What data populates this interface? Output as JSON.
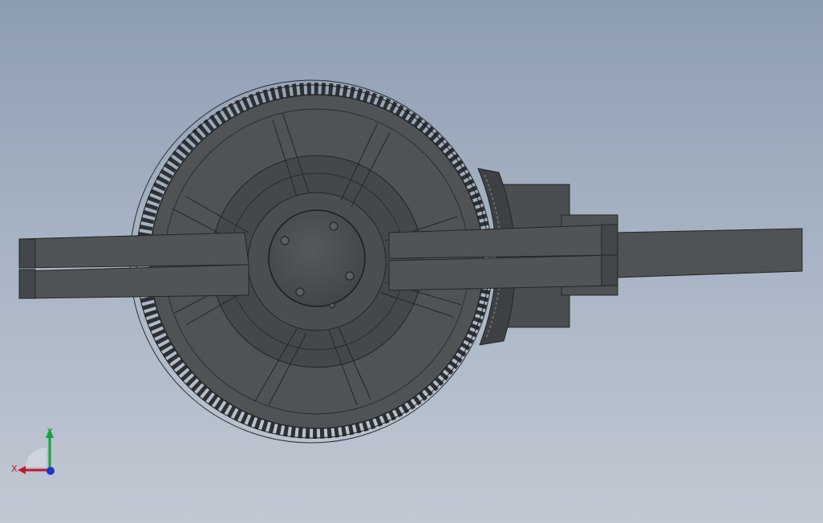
{
  "view": {
    "colors": {
      "background_top": "#8d9db1",
      "background_bottom": "#c1c8d2",
      "part_fill": "#4e5254",
      "part_dark": "#3f4345",
      "edge": "#222628"
    }
  },
  "triad": {
    "x_label": "X",
    "y_label": "Y",
    "x_color": "#c0182a",
    "y_color": "#16a23a",
    "z_color": "#1a35c8"
  }
}
